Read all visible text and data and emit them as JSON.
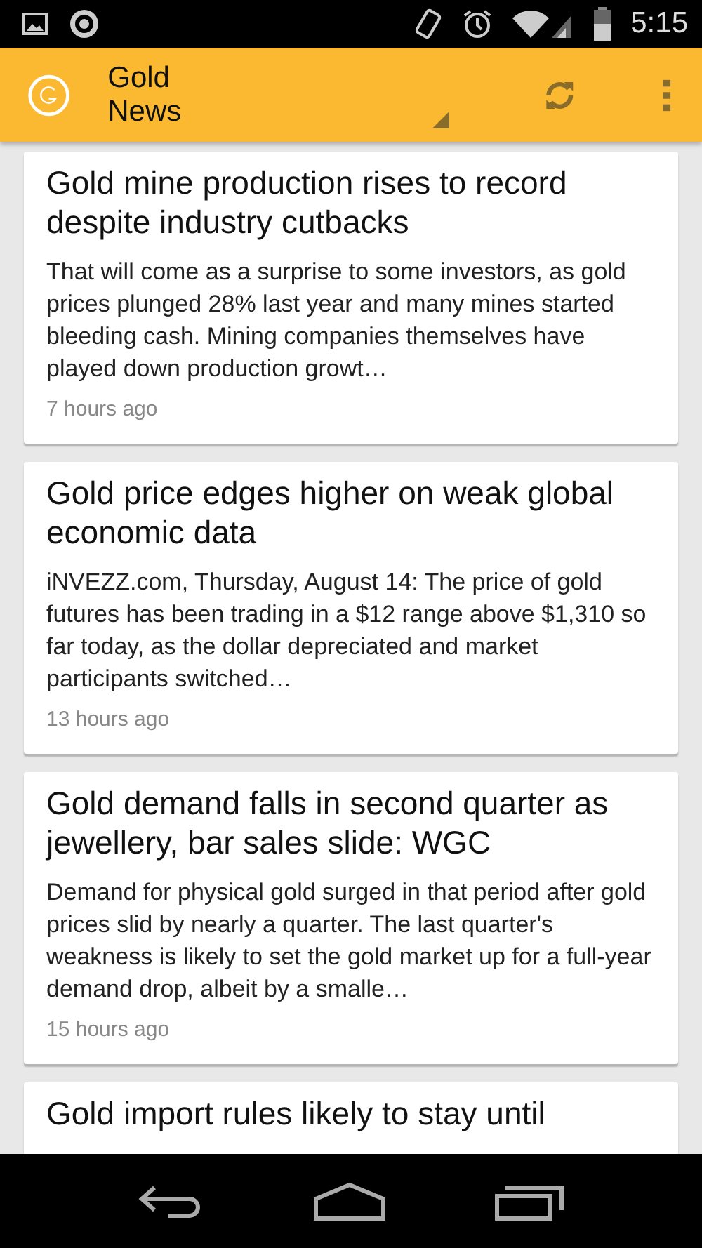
{
  "status_bar": {
    "time": "5:15"
  },
  "app_bar": {
    "title": "Gold News"
  },
  "articles": [
    {
      "title": "Gold mine production rises to record despite industry cutbacks",
      "summary": "That will come as a surprise to some investors, as gold prices plunged 28% last year and many mines started bleeding cash. Mining companies themselves have played down production growt…",
      "time": "7 hours ago"
    },
    {
      "title": "Gold price edges higher on weak global economic data",
      "summary": "iNVEZZ.com, Thursday, August 14: The price of gold futures has been trading in a $12 range above $1,310 so far today, as the dollar depreciated and market participants switched…",
      "time": "13 hours ago"
    },
    {
      "title": "Gold demand falls in second quarter as jewellery, bar sales slide: WGC",
      "summary": "Demand for physical gold surged in that period after gold prices slid by nearly a quarter. The last quarter's weakness is likely to set the gold market up for a full-year demand drop, albeit by a smalle…",
      "time": "15 hours ago"
    },
    {
      "title": "Gold import rules likely to stay until"
    }
  ]
}
